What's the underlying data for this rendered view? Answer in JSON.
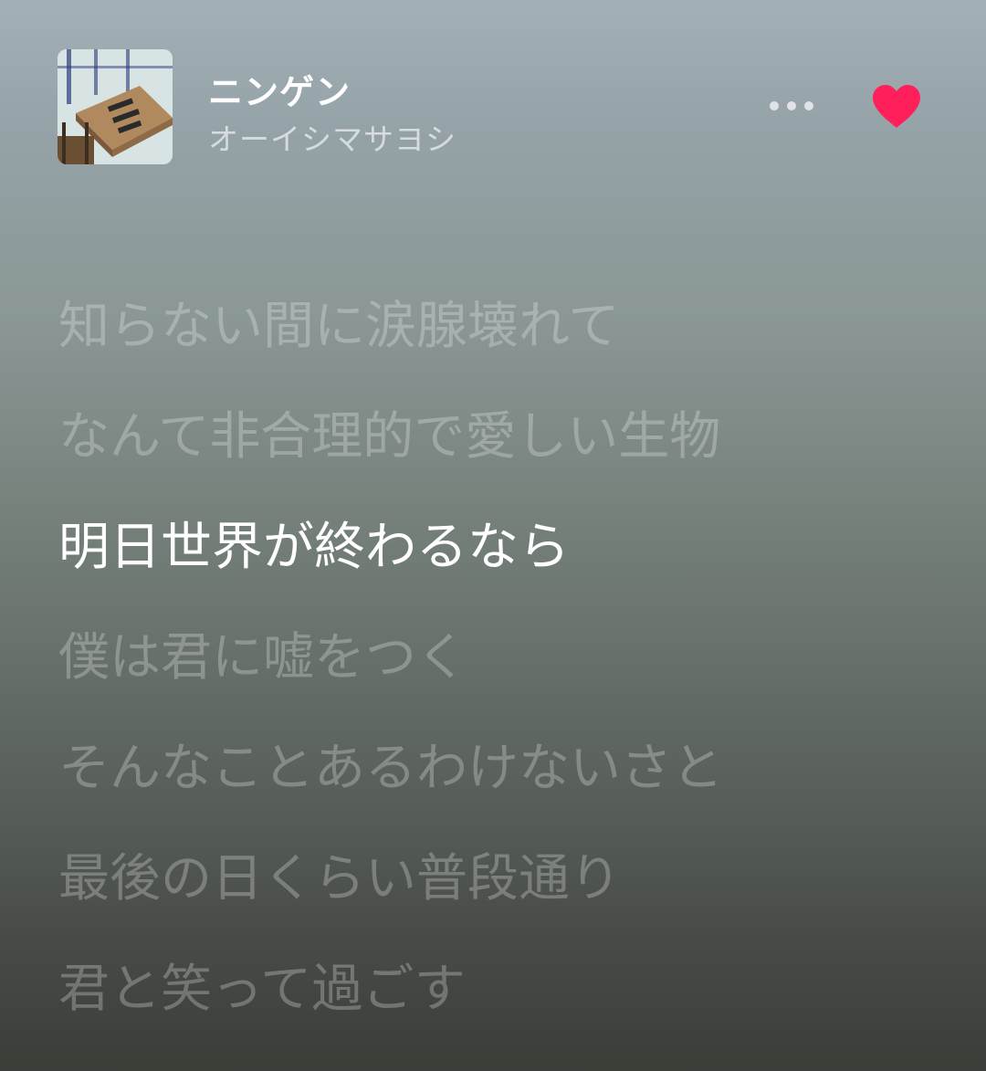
{
  "track": {
    "title": "ニンゲン",
    "artist": "オーイシマサヨシ",
    "liked": true
  },
  "colors": {
    "heart": "#ff1f5a"
  },
  "icons": {
    "more": "more-horizontal-icon",
    "like": "heart-filled-icon"
  },
  "lyrics": [
    {
      "text": "",
      "state": "cut"
    },
    {
      "text": "知らない間に涙腺壊れて",
      "state": "inactive"
    },
    {
      "text": "なんて非合理的で愛しい生物",
      "state": "inactive"
    },
    {
      "text": "明日世界が終わるなら",
      "state": "active"
    },
    {
      "text": "僕は君に嘘をつく",
      "state": "inactive"
    },
    {
      "text": "そんなことあるわけないさと",
      "state": "inactive"
    },
    {
      "text": "最後の日くらい普段通り",
      "state": "inactive"
    },
    {
      "text": "君と笑って過ごす",
      "state": "inactive"
    }
  ]
}
